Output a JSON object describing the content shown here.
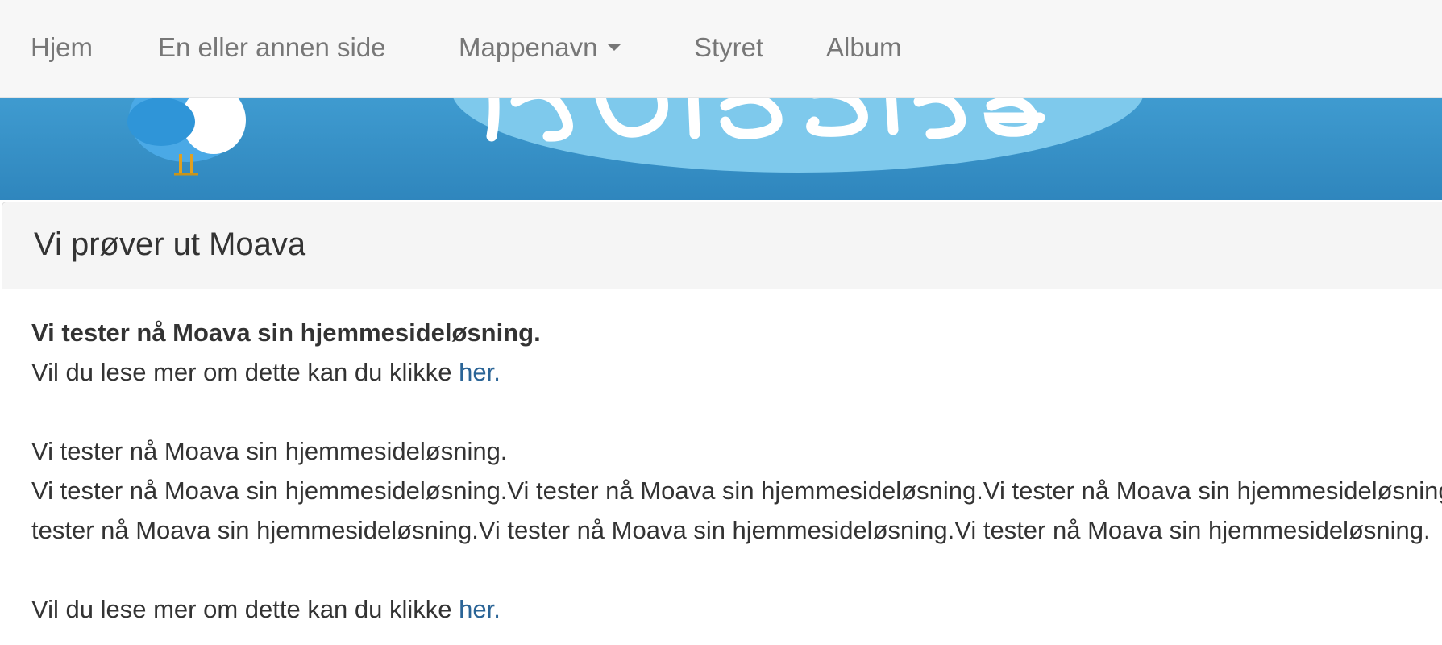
{
  "navbar": {
    "items": [
      {
        "label": "Hjem"
      },
      {
        "label": "En eller annen side"
      },
      {
        "label": "Mappenavn"
      },
      {
        "label": "Styret"
      },
      {
        "label": "Album"
      }
    ]
  },
  "panel": {
    "title": "Vi prøver ut Moava",
    "bold_line": "Vi tester nå Moava sin hjemmesideløsning.",
    "read_more_prefix": "Vil du lese mer om dette kan du klikke ",
    "read_more_link": "her.",
    "paragraph_line_1": "Vi tester nå Moava sin hjemmesideløsning.",
    "paragraph_line_2": "Vi tester nå Moava sin hjemmesideløsning.Vi tester nå Moava sin hjemmesideløsning.Vi tester nå Moava sin hjemmesideløsning.Vi",
    "paragraph_line_3": "tester nå Moava sin hjemmesideløsning.Vi tester nå Moava sin hjemmesideløsning.Vi tester nå Moava sin hjemmesideløsning.",
    "read_more_prefix_2": "Vil du lese mer om dette kan du klikke ",
    "read_more_link_2": "her."
  },
  "colors": {
    "navbar_bg": "#f7f7f7",
    "nav_text": "#777777",
    "banner_blue": "#3a94cb",
    "link": "#2a6496",
    "text": "#333333"
  },
  "icons": {
    "dropdown": "caret-down-icon",
    "banner_bird": "bird-mascot-icon"
  }
}
